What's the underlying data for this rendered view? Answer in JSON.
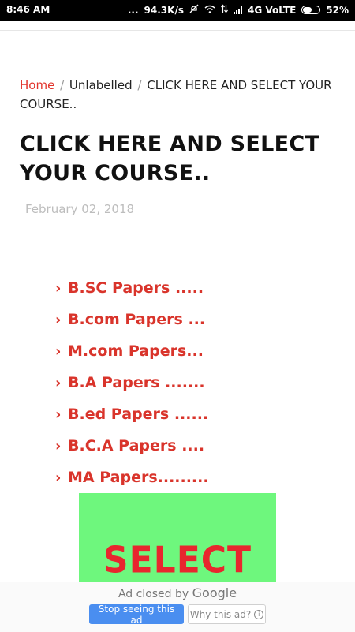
{
  "status_bar": {
    "time": "8:46 AM",
    "dots": "...",
    "speed": "94.3K/s",
    "network": "4G VoLTE",
    "battery": "52%"
  },
  "breadcrumb": {
    "home": "Home",
    "separator": "/",
    "category": "Unlabelled",
    "current": "CLICK HERE AND SELECT YOUR COURSE.."
  },
  "post": {
    "title": "CLICK HERE AND SELECT YOUR COURSE..",
    "date": "February 02, 2018"
  },
  "courses": [
    {
      "icon": "chevron-right-icon",
      "label": "B.SC Papers ....."
    },
    {
      "icon": "chevron-right-icon",
      "label": "B.com Papers ..."
    },
    {
      "icon": "chevron-right-icon",
      "label": "M.com Papers..."
    },
    {
      "icon": "chevron-right-icon",
      "label": "B.A Papers ......."
    },
    {
      "icon": "chevron-right-icon",
      "label": "B.ed Papers ......"
    },
    {
      "icon": "chevron-right-icon",
      "label": "B.C.A Papers ...."
    },
    {
      "icon": "chevron-right-icon",
      "label": "MA Papers........."
    }
  ],
  "banner": {
    "text": "SELECT",
    "background": "#6ef77d",
    "text_color": "#e8262e"
  },
  "ad": {
    "closed_by": "Ad closed by",
    "brand": "Google",
    "stop_label": "Stop seeing this ad",
    "why_label": "Why this ad?"
  },
  "colors": {
    "accent_red": "#d9342b",
    "date_gray": "#bdbdbd",
    "button_blue": "#4a8ef0"
  }
}
